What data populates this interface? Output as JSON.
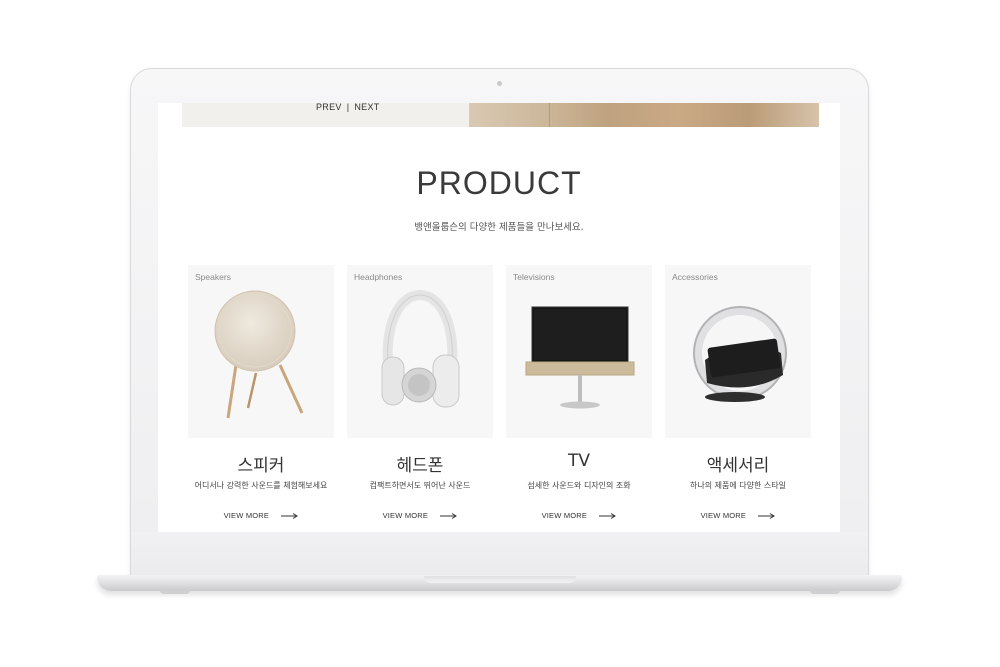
{
  "hero": {
    "prev_label": "PREV",
    "separator": "|",
    "next_label": "NEXT"
  },
  "section": {
    "title": "PRODUCT",
    "subtitle": "뱅앤올룹슨의 다양한 제품들을 만나보세요."
  },
  "products": [
    {
      "category": "Speakers",
      "name": "스피커",
      "description": "어디서나 강력한 사운드를 체험해보세요",
      "more": "VIEW MORE",
      "icon": "speaker-icon"
    },
    {
      "category": "Headphones",
      "name": "헤드폰",
      "description": "컴팩트하면서도 뛰어난 사운드",
      "more": "VIEW MORE",
      "icon": "headphones-icon"
    },
    {
      "category": "Televisions",
      "name": "TV",
      "description": "섬세한 사운드와 디자인의 조화",
      "more": "VIEW MORE",
      "icon": "television-icon"
    },
    {
      "category": "Accessories",
      "name": "액세서리",
      "description": "하나의 제품에 다양한 스타일",
      "more": "VIEW MORE",
      "icon": "accessory-icon"
    }
  ],
  "colors": {
    "card_background": "#f7f7f7",
    "title": "#3a3a3a",
    "laptop_frame": "#f0f0f2"
  }
}
